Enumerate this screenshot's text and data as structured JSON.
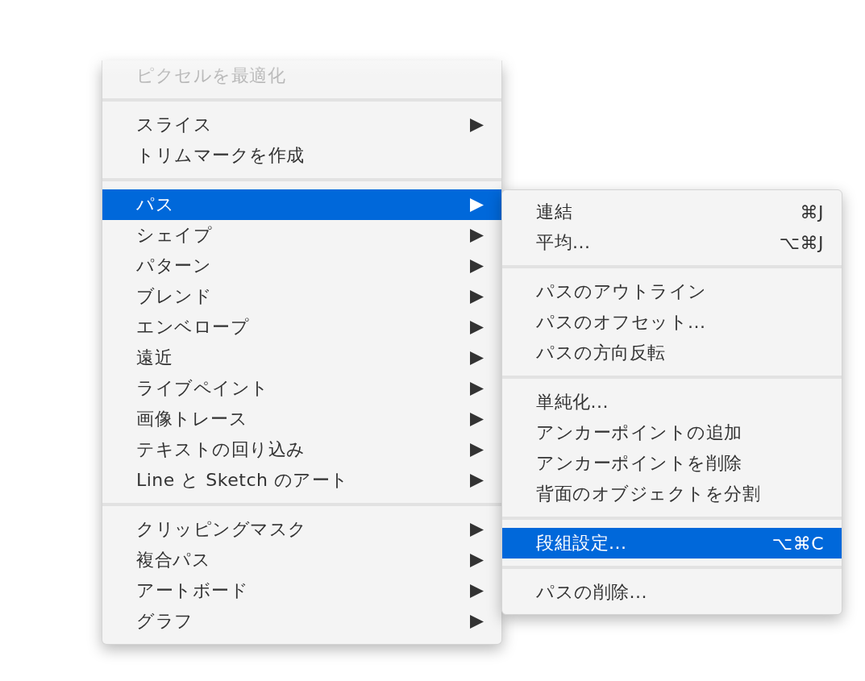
{
  "menu": {
    "sections": [
      [
        {
          "label": "ピクセルを最適化",
          "disabled": true,
          "selected": false,
          "has_submenu": false
        }
      ],
      [
        {
          "label": "スライス",
          "disabled": false,
          "selected": false,
          "has_submenu": true
        },
        {
          "label": "トリムマークを作成",
          "disabled": false,
          "selected": false,
          "has_submenu": false
        }
      ],
      [
        {
          "label": "パス",
          "disabled": false,
          "selected": true,
          "has_submenu": true
        },
        {
          "label": "シェイプ",
          "disabled": false,
          "selected": false,
          "has_submenu": true
        },
        {
          "label": "パターン",
          "disabled": false,
          "selected": false,
          "has_submenu": true
        },
        {
          "label": "ブレンド",
          "disabled": false,
          "selected": false,
          "has_submenu": true
        },
        {
          "label": "エンベロープ",
          "disabled": false,
          "selected": false,
          "has_submenu": true
        },
        {
          "label": "遠近",
          "disabled": false,
          "selected": false,
          "has_submenu": true
        },
        {
          "label": "ライブペイント",
          "disabled": false,
          "selected": false,
          "has_submenu": true
        },
        {
          "label": "画像トレース",
          "disabled": false,
          "selected": false,
          "has_submenu": true
        },
        {
          "label": "テキストの回り込み",
          "disabled": false,
          "selected": false,
          "has_submenu": true
        },
        {
          "label": "Line と Sketch のアート",
          "disabled": false,
          "selected": false,
          "has_submenu": true
        }
      ],
      [
        {
          "label": "クリッピングマスク",
          "disabled": false,
          "selected": false,
          "has_submenu": true
        },
        {
          "label": "複合パス",
          "disabled": false,
          "selected": false,
          "has_submenu": true
        },
        {
          "label": "アートボード",
          "disabled": false,
          "selected": false,
          "has_submenu": true
        },
        {
          "label": "グラフ",
          "disabled": false,
          "selected": false,
          "has_submenu": true
        }
      ]
    ]
  },
  "submenu": {
    "sections": [
      [
        {
          "label": "連結",
          "shortcut": "⌘J",
          "selected": false
        },
        {
          "label": "平均...",
          "shortcut": "⌥⌘J",
          "selected": false
        }
      ],
      [
        {
          "label": "パスのアウトライン",
          "selected": false
        },
        {
          "label": "パスのオフセット...",
          "selected": false
        },
        {
          "label": "パスの方向反転",
          "selected": false
        }
      ],
      [
        {
          "label": "単純化...",
          "selected": false
        },
        {
          "label": "アンカーポイントの追加",
          "selected": false
        },
        {
          "label": "アンカーポイントを削除",
          "selected": false
        },
        {
          "label": "背面のオブジェクトを分割",
          "selected": false
        }
      ],
      [
        {
          "label": "段組設定...",
          "shortcut": "⌥⌘C",
          "selected": true
        }
      ],
      [
        {
          "label": "パスの削除...",
          "selected": false
        }
      ]
    ]
  }
}
